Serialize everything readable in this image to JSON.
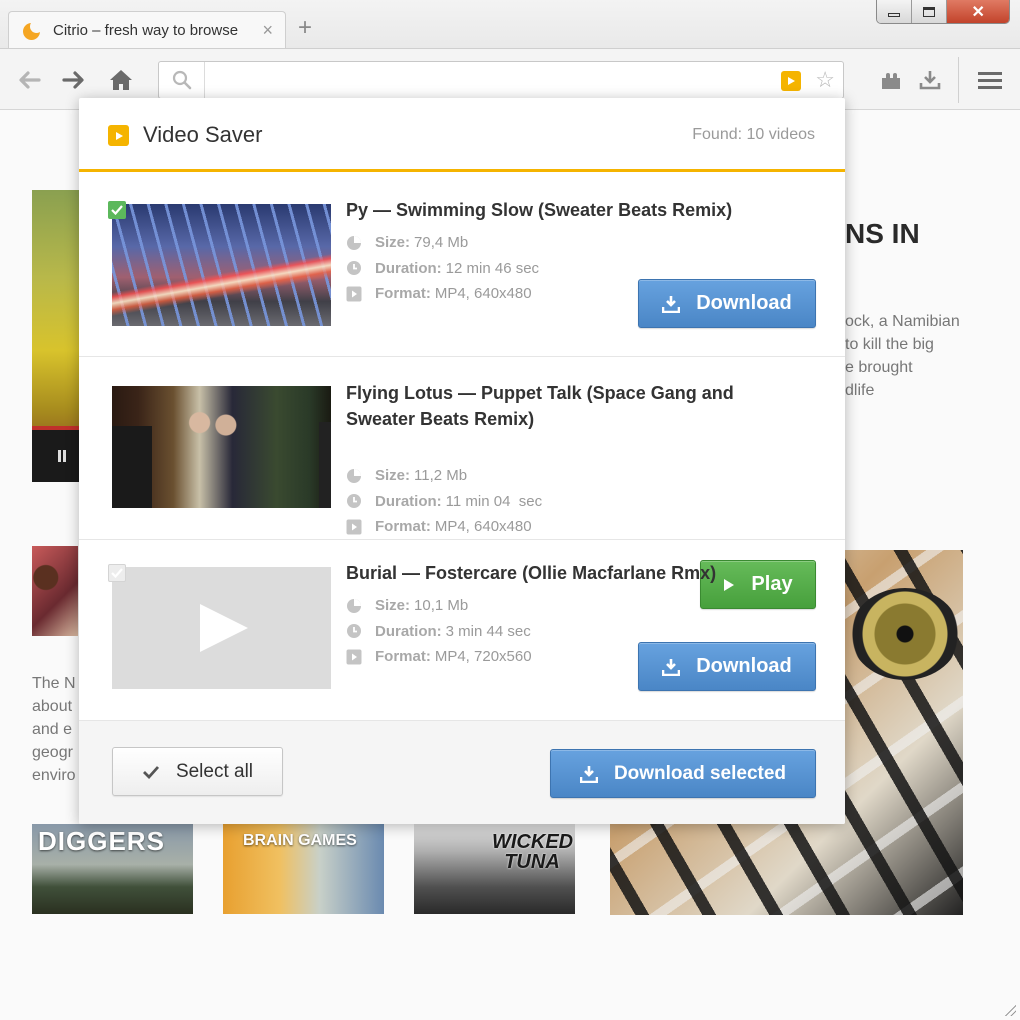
{
  "browser": {
    "tab_title": "Citrio – fresh way to browse",
    "tab_close": "×",
    "new_tab": "+",
    "window_close": "✕"
  },
  "page": {
    "headline": "NS IN",
    "article_lines": [
      "ock, a Namibian",
      "to kill the big",
      "e brought",
      "dlife"
    ],
    "side_text_lines": [
      "The N",
      "about",
      "and e",
      "geogr",
      "enviro"
    ],
    "thumbs": [
      "DIGGERS",
      "BRAIN GAMES",
      "WICKED TUNA"
    ]
  },
  "popup": {
    "title": "Video Saver",
    "found": "Found: 10 videos",
    "labels": {
      "size": "Size:",
      "duration": "Duration:",
      "format": "Format:"
    },
    "videos": [
      {
        "title": "Py — Swimming Slow (Sweater Beats Remix)",
        "size": "79,4 Mb",
        "duration": "12 min 46 sec",
        "format": "MP4, 640x480",
        "action": "Download",
        "checked": true
      },
      {
        "title": "Flying Lotus — Puppet Talk (Space Gang and Sweater Beats Remix)",
        "size": "11,2 Mb",
        "duration": "11 min 04  sec",
        "format": "MP4, 640x480",
        "action": "Play",
        "checked": false
      },
      {
        "title": "Burial — Fostercare (Ollie Macfarlane Rmx)",
        "size": "10,1 Mb",
        "duration": "3 min 44 sec",
        "format": "MP4, 720x560",
        "action": "Download",
        "checked": false
      }
    ],
    "select_all": "Select all",
    "download_selected": "Download selected"
  },
  "colors": {
    "accent": "#f5b400",
    "download_blue": "#4a86c6",
    "play_green": "#47a03c",
    "check_green": "#5cb85c"
  }
}
